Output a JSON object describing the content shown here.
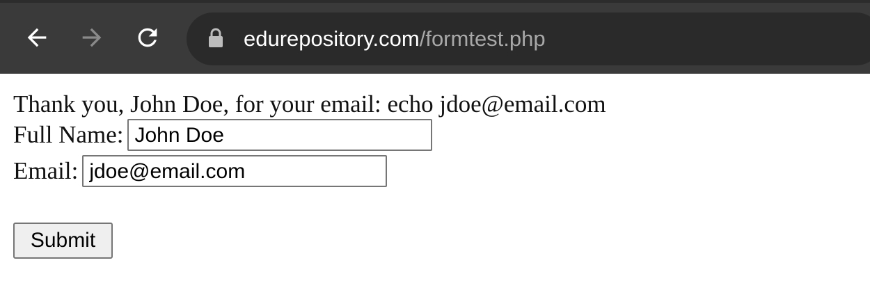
{
  "browser": {
    "url_host": "edurepository.com",
    "url_path": "/formtest.php",
    "back_icon": "arrow-left-icon",
    "forward_icon": "arrow-right-icon",
    "reload_icon": "reload-icon",
    "lock_icon": "lock-icon",
    "bar_color": "#3a3a3a",
    "omnibox_color": "#2a2a2a"
  },
  "page": {
    "thank_you_text": "Thank you, John Doe, for your email: echo jdoe@email.com",
    "name_label": "Full Name:",
    "name_value": "John Doe",
    "email_label": "Email:",
    "email_value": "jdoe@email.com",
    "submit_label": "Submit"
  }
}
